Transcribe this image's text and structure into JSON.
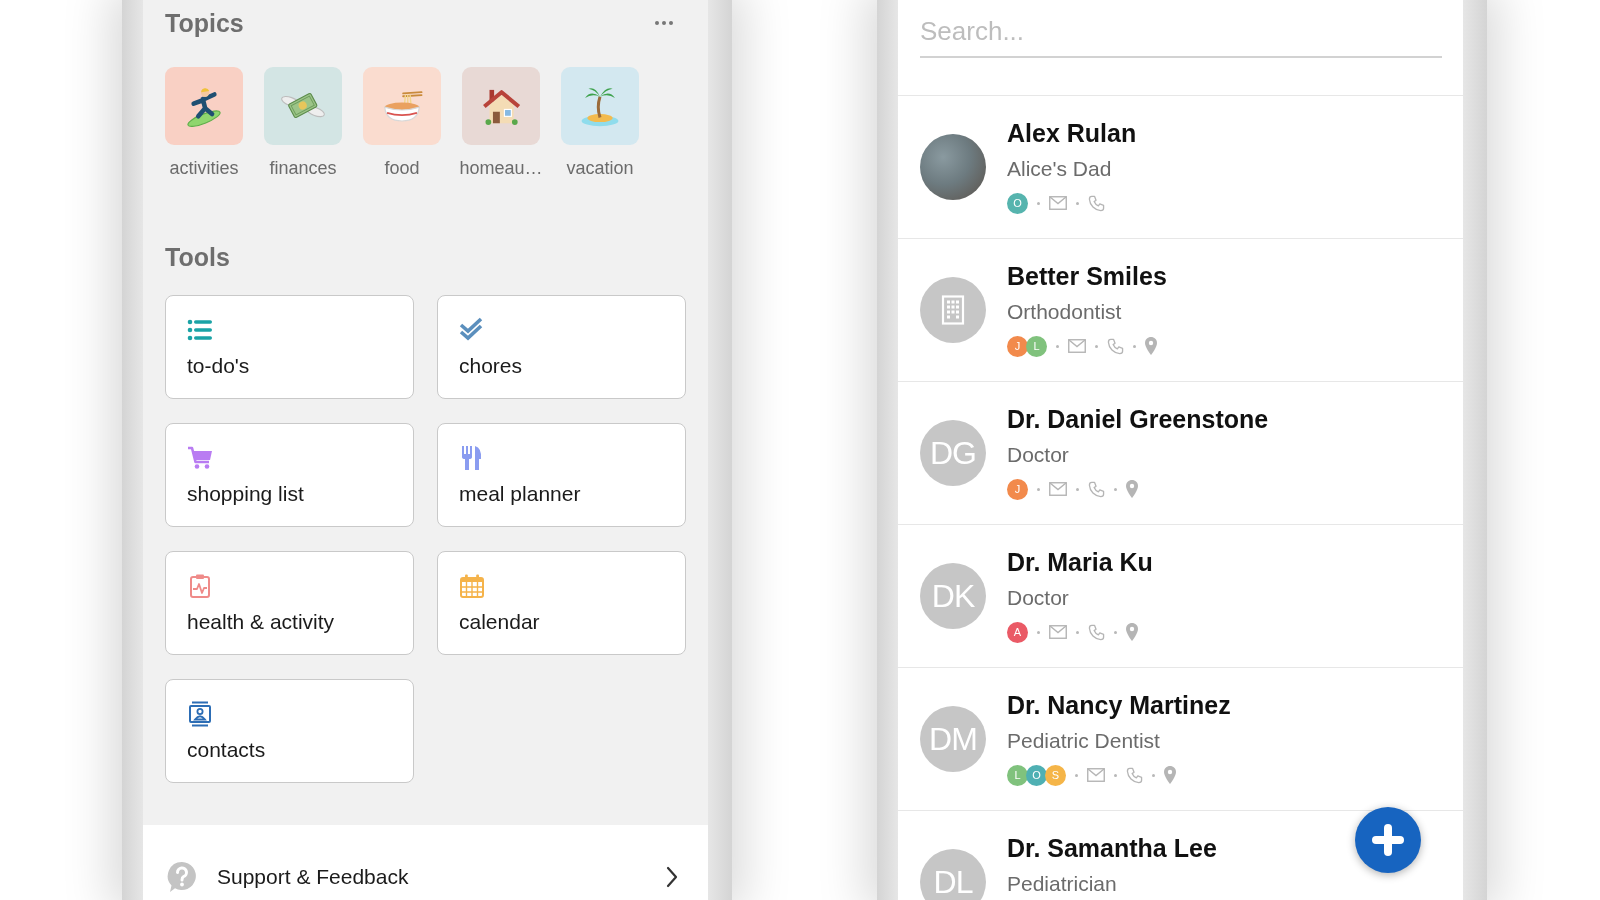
{
  "topics": {
    "title": "Topics",
    "items": [
      {
        "label": "activities",
        "color": "#f9d0c4"
      },
      {
        "label": "finances",
        "color": "#d3e5e4"
      },
      {
        "label": "food",
        "color": "#fadccf"
      },
      {
        "label": "homeau…",
        "color": "#e8d9d5"
      },
      {
        "label": "vacation",
        "color": "#d3e8f0"
      }
    ]
  },
  "tools": {
    "title": "Tools",
    "items": [
      {
        "label": "to-do's",
        "color": "#1aa3a6"
      },
      {
        "label": "chores",
        "color": "#5b8fbd"
      },
      {
        "label": "shopping list",
        "color": "#b97cf2"
      },
      {
        "label": "meal planner",
        "color": "#8a9cf0"
      },
      {
        "label": "health & activity",
        "color": "#ef8b89"
      },
      {
        "label": "calendar",
        "color": "#f5b34a"
      },
      {
        "label": "contacts",
        "color": "#2c6db5"
      }
    ]
  },
  "support": {
    "label": "Support & Feedback"
  },
  "contacts": {
    "search": {
      "placeholder": "Search..."
    },
    "items": [
      {
        "name": "Alex Rulan",
        "subtitle": "Alice's Dad",
        "avatar": {
          "kind": "photo"
        },
        "members": [
          {
            "initial": "O",
            "color": "#56b4ae"
          }
        ],
        "methods": [
          {
            "kind": "email"
          },
          {
            "kind": "phone"
          }
        ]
      },
      {
        "name": "Better Smiles",
        "subtitle": "Orthodontist",
        "avatar": {
          "kind": "building"
        },
        "members": [
          {
            "initial": "J",
            "color": "#f28a4c"
          },
          {
            "initial": "L",
            "color": "#80c27d"
          }
        ],
        "methods": [
          {
            "kind": "email"
          },
          {
            "kind": "phone"
          },
          {
            "kind": "location"
          }
        ]
      },
      {
        "name": "Dr. Daniel Greenstone",
        "subtitle": "Doctor",
        "avatar": {
          "kind": "initials",
          "initials": "DG"
        },
        "members": [
          {
            "initial": "J",
            "color": "#f28a4c"
          }
        ],
        "methods": [
          {
            "kind": "email"
          },
          {
            "kind": "phone"
          },
          {
            "kind": "location"
          }
        ]
      },
      {
        "name": "Dr. Maria Ku",
        "subtitle": "Doctor",
        "avatar": {
          "kind": "initials",
          "initials": "DK"
        },
        "members": [
          {
            "initial": "A",
            "color": "#ea5a66"
          }
        ],
        "methods": [
          {
            "kind": "email"
          },
          {
            "kind": "phone"
          },
          {
            "kind": "location"
          }
        ]
      },
      {
        "name": "Dr. Nancy Martinez",
        "subtitle": "Pediatric Dentist",
        "avatar": {
          "kind": "initials",
          "initials": "DM"
        },
        "members": [
          {
            "initial": "L",
            "color": "#80c27d"
          },
          {
            "initial": "O",
            "color": "#4fb0b3"
          },
          {
            "initial": "S",
            "color": "#f5b548"
          }
        ],
        "methods": [
          {
            "kind": "email"
          },
          {
            "kind": "phone"
          },
          {
            "kind": "location"
          }
        ]
      },
      {
        "name": "Dr. Samantha Lee",
        "subtitle": "Pediatrician",
        "avatar": {
          "kind": "initials",
          "initials": "DL"
        }
      }
    ]
  }
}
